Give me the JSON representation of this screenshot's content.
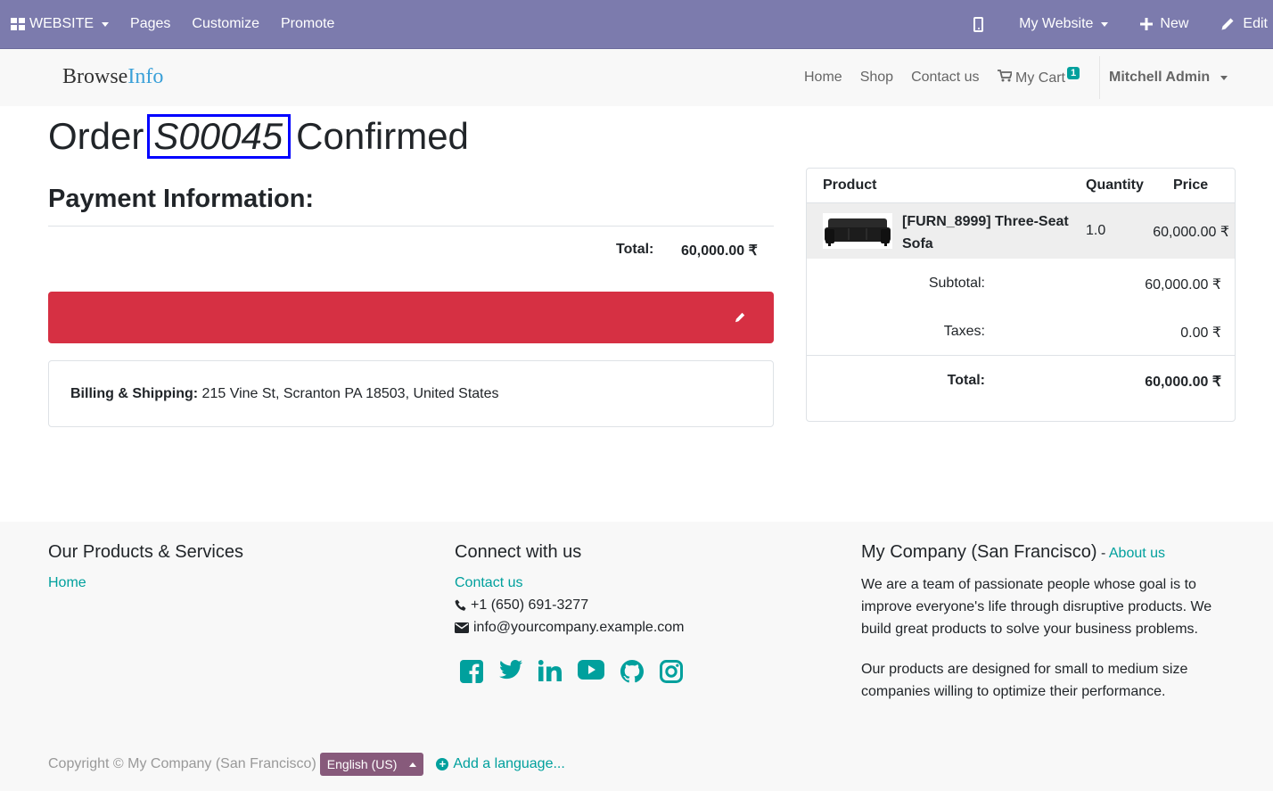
{
  "topbar": {
    "website_label": "WEBSITE",
    "pages_label": "Pages",
    "customize_label": "Customize",
    "promote_label": "Promote",
    "mywebsite_label": "My Website",
    "new_label": "New",
    "edit_label": "Edit"
  },
  "header": {
    "brand_part1": "Browse",
    "brand_part2": "Info",
    "nav": {
      "home": "Home",
      "shop": "Shop",
      "contact": "Contact us",
      "cart": "My Cart",
      "cart_count": "1"
    },
    "user": "Mitchell Admin"
  },
  "order": {
    "prefix": "Order",
    "number": "S00045",
    "suffix": "Confirmed"
  },
  "payment": {
    "heading": "Payment Information:",
    "total_label": "Total:",
    "total_value": "60,000.00 ₹"
  },
  "billing": {
    "label": "Billing & Shipping:",
    "address": "215 Vine St, Scranton PA 18503, United States"
  },
  "summary": {
    "headers": {
      "product": "Product",
      "quantity": "Quantity",
      "price": "Price"
    },
    "item": {
      "name": "[FURN_8999] Three-Seat Sofa",
      "qty": "1.0",
      "price": "60,000.00 ₹"
    },
    "subtotal_label": "Subtotal:",
    "subtotal_value": "60,000.00 ₹",
    "taxes_label": "Taxes:",
    "taxes_value": "0.00 ₹",
    "total_label": "Total:",
    "total_value": "60,000.00 ₹"
  },
  "footer": {
    "col1_title": "Our Products & Services",
    "col1_link": "Home",
    "col2_title": "Connect with us",
    "col2_contact": "Contact us",
    "phone": "+1 (650) 691-3277",
    "email": "info@yourcompany.example.com",
    "col3_title": "My Company (San Francisco)",
    "col3_sep": " - ",
    "col3_link": "About us",
    "para1": "We are a team of passionate people whose goal is to improve everyone's life through disruptive products. We build great products to solve your business problems.",
    "para2": "Our products are designed for small to medium size companies willing to optimize their performance.",
    "copyright": "Copyright © My Company (San Francisco)",
    "language": "English (US)",
    "add_language": "Add a language...",
    "social_icons": [
      "facebook-icon",
      "twitter-icon",
      "linkedin-icon",
      "youtube-icon",
      "github-icon",
      "instagram-icon"
    ]
  },
  "colors": {
    "topbar": "#7c7bad",
    "accent": "#00a09d",
    "alert": "#d63043",
    "language_button": "#875a7b"
  }
}
